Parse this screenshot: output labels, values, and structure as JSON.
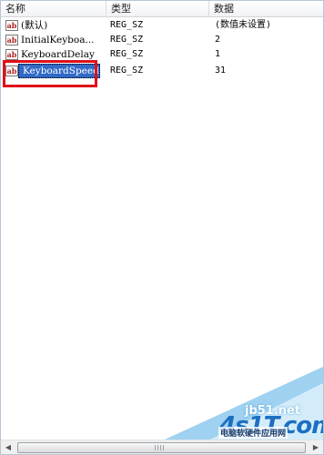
{
  "columns": {
    "name": "名称",
    "type": "类型",
    "data": "数据"
  },
  "icon": {
    "name": "string-value-icon",
    "glyph": "ab"
  },
  "rows": [
    {
      "name": "(默认)",
      "type": "REG_SZ",
      "data": "(数值未设置)"
    },
    {
      "name": "InitialKeyboa...",
      "type": "REG_SZ",
      "data": "2"
    },
    {
      "name": "KeyboardDelay",
      "type": "REG_SZ",
      "data": "1"
    },
    {
      "name": "KeyboardSpeed",
      "type": "REG_SZ",
      "data": "31",
      "selected": true
    }
  ],
  "watermark": {
    "site": "jb51.net",
    "logo": "4s1T.com",
    "tagline": "电脑软硬件应用网"
  },
  "colors": {
    "selection": "#3169c6",
    "highlight_border": "#e0101a",
    "icon_text": "#b02020"
  }
}
